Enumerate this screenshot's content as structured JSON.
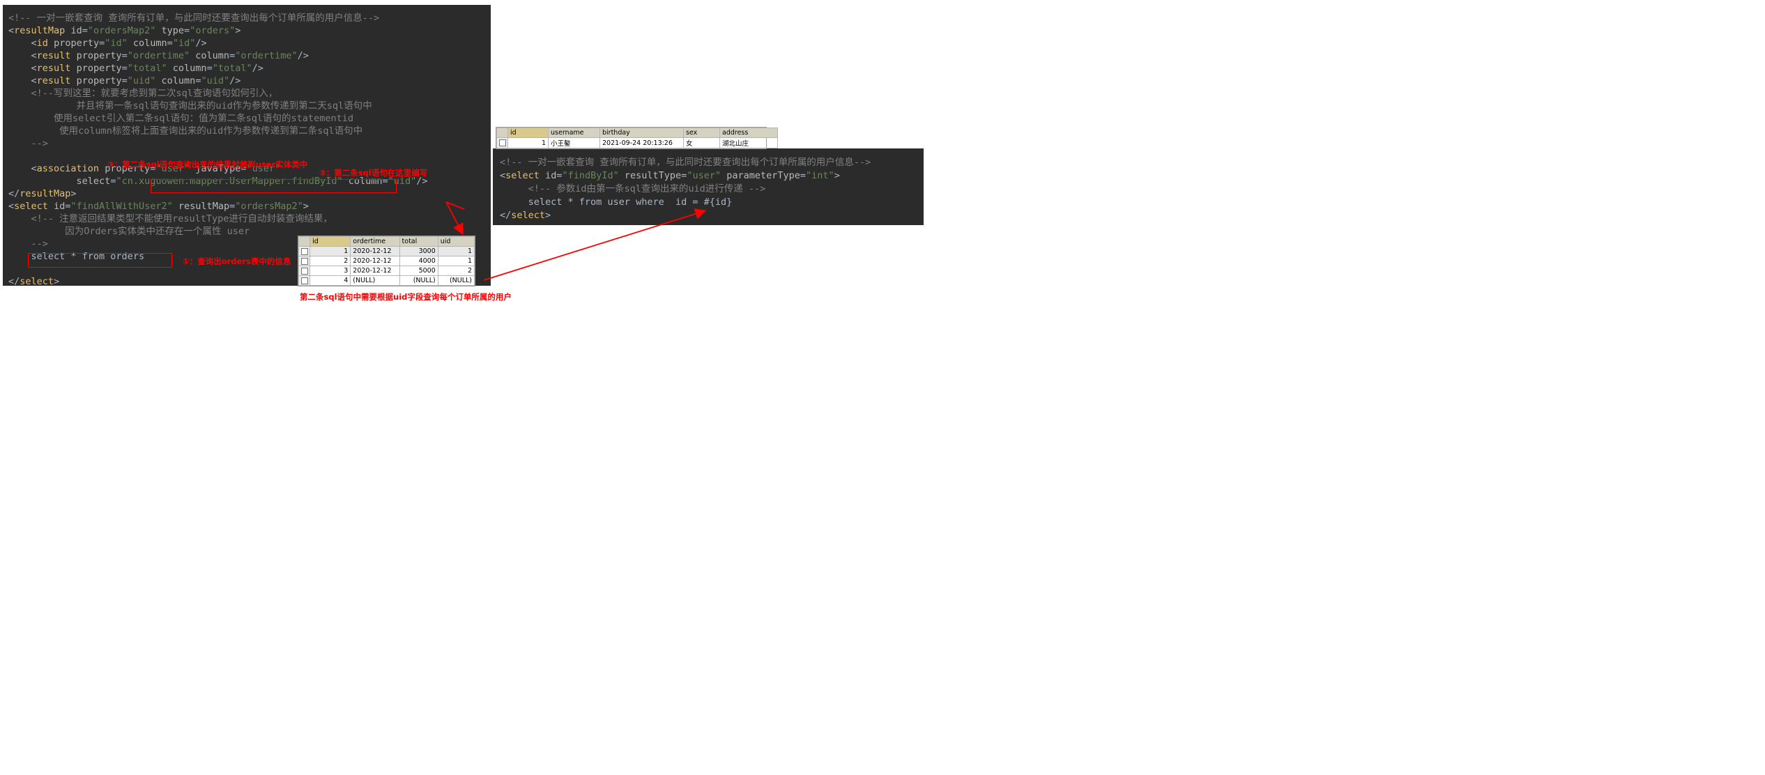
{
  "left_panel": {
    "name": "orders-mapper-xml",
    "lines": [
      [
        {
          "t": "cmt",
          "v": "<!-- 一对一嵌套查询 查询所有订单，与此同时还要查询出每个订单所属的用户信息-->"
        }
      ],
      [
        {
          "t": "punc",
          "v": "<"
        },
        {
          "t": "tag",
          "v": "resultMap"
        },
        {
          "t": "plain",
          "v": " "
        },
        {
          "t": "attr",
          "v": "id"
        },
        {
          "t": "punc",
          "v": "="
        },
        {
          "t": "str",
          "v": "\"ordersMap2\""
        },
        {
          "t": "plain",
          "v": " "
        },
        {
          "t": "attr",
          "v": "type"
        },
        {
          "t": "punc",
          "v": "="
        },
        {
          "t": "str",
          "v": "\"orders\""
        },
        {
          "t": "punc",
          "v": ">"
        }
      ],
      [
        {
          "t": "plain",
          "v": "    "
        },
        {
          "t": "punc",
          "v": "<"
        },
        {
          "t": "tag",
          "v": "id"
        },
        {
          "t": "plain",
          "v": " "
        },
        {
          "t": "attr",
          "v": "property"
        },
        {
          "t": "punc",
          "v": "="
        },
        {
          "t": "str",
          "v": "\"id\""
        },
        {
          "t": "plain",
          "v": " "
        },
        {
          "t": "attr",
          "v": "column"
        },
        {
          "t": "punc",
          "v": "="
        },
        {
          "t": "str",
          "v": "\"id\""
        },
        {
          "t": "punc",
          "v": "/>"
        }
      ],
      [
        {
          "t": "plain",
          "v": "    "
        },
        {
          "t": "punc",
          "v": "<"
        },
        {
          "t": "tag",
          "v": "result"
        },
        {
          "t": "plain",
          "v": " "
        },
        {
          "t": "attr",
          "v": "property"
        },
        {
          "t": "punc",
          "v": "="
        },
        {
          "t": "str",
          "v": "\"ordertime\""
        },
        {
          "t": "plain",
          "v": " "
        },
        {
          "t": "attr",
          "v": "column"
        },
        {
          "t": "punc",
          "v": "="
        },
        {
          "t": "str",
          "v": "\"ordertime\""
        },
        {
          "t": "punc",
          "v": "/>"
        }
      ],
      [
        {
          "t": "plain",
          "v": "    "
        },
        {
          "t": "punc",
          "v": "<"
        },
        {
          "t": "tag",
          "v": "result"
        },
        {
          "t": "plain",
          "v": " "
        },
        {
          "t": "attr",
          "v": "property"
        },
        {
          "t": "punc",
          "v": "="
        },
        {
          "t": "str",
          "v": "\"total\""
        },
        {
          "t": "plain",
          "v": " "
        },
        {
          "t": "attr",
          "v": "column"
        },
        {
          "t": "punc",
          "v": "="
        },
        {
          "t": "str",
          "v": "\"total\""
        },
        {
          "t": "punc",
          "v": "/>"
        }
      ],
      [
        {
          "t": "plain",
          "v": "    "
        },
        {
          "t": "punc",
          "v": "<"
        },
        {
          "t": "tag",
          "v": "result"
        },
        {
          "t": "plain",
          "v": " "
        },
        {
          "t": "attr",
          "v": "property"
        },
        {
          "t": "punc",
          "v": "="
        },
        {
          "t": "str",
          "v": "\"uid\""
        },
        {
          "t": "plain",
          "v": " "
        },
        {
          "t": "attr",
          "v": "column"
        },
        {
          "t": "punc",
          "v": "="
        },
        {
          "t": "str",
          "v": "\"uid\""
        },
        {
          "t": "punc",
          "v": "/>"
        }
      ],
      [
        {
          "t": "cmt",
          "v": "    <!--写到这里：就要考虑到第二次sql查询语句如何引入，"
        }
      ],
      [
        {
          "t": "cmt",
          "v": "            并且将第一条sql语句查询出来的uid作为参数传递到第二天sql语句中"
        }
      ],
      [
        {
          "t": "cmt",
          "v": "        使用select引入第二条sql语句：值为第二条sql语句的statementid"
        }
      ],
      [
        {
          "t": "cmt",
          "v": "         使用column标签将上面查询出来的uid作为参数传递到第二条sql语句中"
        }
      ],
      [
        {
          "t": "cmt",
          "v": "    -->"
        }
      ],
      [
        {
          "t": "plain",
          "v": ""
        }
      ],
      [
        {
          "t": "plain",
          "v": "    "
        },
        {
          "t": "punc",
          "v": "<"
        },
        {
          "t": "tag",
          "v": "association"
        },
        {
          "t": "plain",
          "v": " "
        },
        {
          "t": "attr",
          "v": "property"
        },
        {
          "t": "punc",
          "v": "="
        },
        {
          "t": "str",
          "v": "\"user\""
        },
        {
          "t": "plain",
          "v": " "
        },
        {
          "t": "attr",
          "v": "javaType"
        },
        {
          "t": "punc",
          "v": "="
        },
        {
          "t": "str",
          "v": "\"user\""
        }
      ],
      [
        {
          "t": "plain",
          "v": "            "
        },
        {
          "t": "attr",
          "v": "select"
        },
        {
          "t": "punc",
          "v": "="
        },
        {
          "t": "str",
          "v": "\"cn.xuguowen.mapper.UserMapper.findById\""
        },
        {
          "t": "plain",
          "v": " "
        },
        {
          "t": "attr",
          "v": "column"
        },
        {
          "t": "punc",
          "v": "="
        },
        {
          "t": "str",
          "v": "\"uid\""
        },
        {
          "t": "punc",
          "v": "/>"
        }
      ],
      [
        {
          "t": "punc",
          "v": "</"
        },
        {
          "t": "tag",
          "v": "resultMap"
        },
        {
          "t": "punc",
          "v": ">"
        }
      ],
      [
        {
          "t": "punc",
          "v": "<"
        },
        {
          "t": "tag",
          "v": "select"
        },
        {
          "t": "plain",
          "v": " "
        },
        {
          "t": "attr",
          "v": "id"
        },
        {
          "t": "punc",
          "v": "="
        },
        {
          "t": "str",
          "v": "\"findAllWithUser2\""
        },
        {
          "t": "plain",
          "v": " "
        },
        {
          "t": "attr",
          "v": "resultMap"
        },
        {
          "t": "punc",
          "v": "="
        },
        {
          "t": "str",
          "v": "\"ordersMap2\""
        },
        {
          "t": "punc",
          "v": ">"
        }
      ],
      [
        {
          "t": "cmt",
          "v": "    <!-- 注意返回结果类型不能使用resultType进行自动封装查询结果，"
        }
      ],
      [
        {
          "t": "cmt",
          "v": "          因为Orders实体类中还存在一个属性 user"
        }
      ],
      [
        {
          "t": "cmt",
          "v": "    -->"
        }
      ],
      [
        {
          "t": "plain",
          "v": "    "
        },
        {
          "t": "plain",
          "v": "select * from orders"
        }
      ],
      [
        {
          "t": "plain",
          "v": ""
        }
      ],
      [
        {
          "t": "punc",
          "v": "</"
        },
        {
          "t": "tag",
          "v": "select"
        },
        {
          "t": "punc",
          "v": ">"
        }
      ]
    ]
  },
  "right_panel": {
    "name": "user-mapper-xml",
    "lines": [
      [
        {
          "t": "cmt",
          "v": "<!-- 一对一嵌套查询 查询所有订单，与此同时还要查询出每个订单所属的用户信息-->"
        }
      ],
      [
        {
          "t": "punc",
          "v": "<"
        },
        {
          "t": "tag",
          "v": "select"
        },
        {
          "t": "plain",
          "v": " "
        },
        {
          "t": "attr",
          "v": "id"
        },
        {
          "t": "punc",
          "v": "="
        },
        {
          "t": "str",
          "v": "\"findById\""
        },
        {
          "t": "plain",
          "v": " "
        },
        {
          "t": "attr",
          "v": "resultType"
        },
        {
          "t": "punc",
          "v": "="
        },
        {
          "t": "str",
          "v": "\"user\""
        },
        {
          "t": "plain",
          "v": " "
        },
        {
          "t": "attr",
          "v": "parameterType"
        },
        {
          "t": "punc",
          "v": "="
        },
        {
          "t": "str",
          "v": "\"int\""
        },
        {
          "t": "punc",
          "v": ">"
        }
      ],
      [
        {
          "t": "cmt",
          "v": "     <!-- 参数id由第一条sql查询出来的uid进行传递 -->"
        }
      ],
      [
        {
          "t": "plain",
          "v": "     select * from user where  id = #{id}"
        }
      ],
      [
        {
          "t": "punc",
          "v": "</"
        },
        {
          "t": "tag",
          "v": "select"
        },
        {
          "t": "punc",
          "v": ">"
        }
      ]
    ]
  },
  "annotations": {
    "note_3": "③：第二条sql语句查询出来的结果封装到user实体类中",
    "note_2": "②：第二条sql语句在这里编写",
    "note_1": "①：查询出orders表中的信息",
    "caption": "第二条sql语句中需要根据uid字段查询每个订单所属的用户"
  },
  "orders_grid": {
    "name": "orders-result-grid",
    "columns": [
      "id",
      "ordertime",
      "total",
      "uid"
    ],
    "highlight_column": "uid",
    "rows": [
      {
        "selected": true,
        "id": "1",
        "ordertime": "2020-12-12",
        "total": "3000",
        "uid": "1"
      },
      {
        "selected": false,
        "id": "2",
        "ordertime": "2020-12-12",
        "total": "4000",
        "uid": "1"
      },
      {
        "selected": false,
        "id": "3",
        "ordertime": "2020-12-12",
        "total": "5000",
        "uid": "2"
      },
      {
        "selected": false,
        "id": "4",
        "ordertime": "(NULL)",
        "total": "(NULL)",
        "uid": "(NULL)"
      }
    ]
  },
  "user_grid": {
    "name": "user-result-grid",
    "columns": [
      "id",
      "username",
      "birthday",
      "sex",
      "address"
    ],
    "highlight_column": "id",
    "rows": [
      {
        "selected": false,
        "id": "1",
        "username": "小王鏊",
        "birthday": "2021-09-24 20:13:26",
        "sex": "女",
        "address": "湖北山庄"
      }
    ]
  },
  "colors": {
    "editor_bg": "#2b2b2b",
    "comment": "#808080",
    "tag": "#e8bf6a",
    "string": "#6a8759",
    "plain": "#a9b7c6",
    "annotation_red": "#ff0000",
    "grid_header": "#d6d2c2",
    "grid_header_selected": "#d9ca8c"
  }
}
